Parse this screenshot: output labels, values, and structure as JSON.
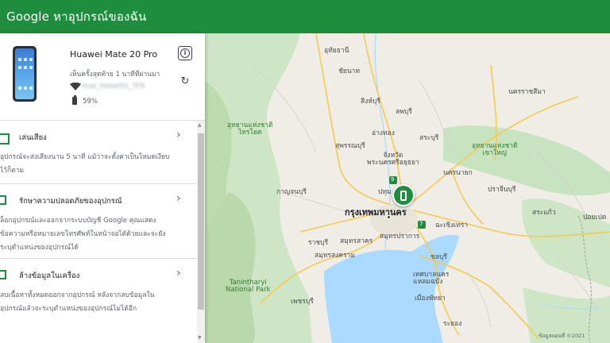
{
  "header": {
    "title": "Google หาอุปกรณ์ของฉัน"
  },
  "device": {
    "name": "Huawei Mate 20 Pro",
    "last_seen": "เห็นครั้งสุดท้าย 1 นาทีที่ผ่านมา",
    "wifi_name": "true_home5G_7F9",
    "battery": "59%"
  },
  "actions": [
    {
      "title": "เล่นเสียง",
      "description": "อุปกรณ์จะส่งเสียงนาน 5 นาที แม้ว่าจะตั้งค่าเป็นโหมดเงียบไว้ก็ตาม"
    },
    {
      "title": "รักษาความปลอดภัยของอุปกรณ์",
      "description": "ล็อกอุปกรณ์และออกจากระบบบัญชี Google คุณแสดงข้อความหรือหมายเลขโทรศัพท์ในหน้าจอได้ด้วยและจะยังระบุตำแหน่งของอุปกรณ์ได้"
    },
    {
      "title": "ล้างข้อมูลในเครื่อง",
      "description": "ลบเนื้อหาทั้งหมดออกจากอุปกรณ์ หลังจากลบข้อมูลในอุปกรณ์แล้วจะระบุตำแหน่งของอุปกรณ์ไม่ได้อีก"
    }
  ],
  "map": {
    "labels": {
      "uthaithani": "อุทัยธานี",
      "chainat": "ชัยนาท",
      "singburi": "สิงห์บุรี",
      "nakhonratchasima": "นครราชสีมา",
      "lopburi": "ลพบุรี",
      "saraburi": "สระบุรี",
      "angthong": "อ่างทอง",
      "suphanburi": "สุพรรณบุรี",
      "ayutthaya": "จังหวัด\nพระนครศรีอยุธยา",
      "khaoyai": "อุทยานแห่งชาติ\nเขาใหญ่",
      "srisawat": "อุทยานแห่งชาติ\nไทรโยค",
      "kanchanaburi": "กาญจนบุรี",
      "pathum": "ปทุม",
      "nakhonnayok": "นครนายก",
      "prachinburi": "ปราจีนบุรี",
      "bangkok": "กรุงเทพมหานคร",
      "chachoengsao": "ฉะเชิงเทรา",
      "sakaeo": "สระแก้ว",
      "poipet": "ปอยเปต",
      "ratchaburi": "ราชบุรี",
      "samutsakhon": "สมุทรสาคร",
      "samutsongkhram": "สมุทรสงคราม",
      "samutprakan": "สมุทรปราการ",
      "chonburi": "ชลบุรี",
      "tanintharyi": "Tanintharyi\nNational Park",
      "phetchaburi": "เพชรบุรี",
      "laemchabang": "เทศบาลนคร\nแหลมฉบัง",
      "pattaya": "เมืองพัทยา",
      "rayong": "ระยอง",
      "road_one": "9",
      "road_two": "7"
    },
    "attribution": "ข้อมูลแผนที่ ©2021"
  },
  "colors": {
    "brand": "#1e8e3e",
    "water": "#aadaff",
    "park": "#c8e6c9"
  }
}
